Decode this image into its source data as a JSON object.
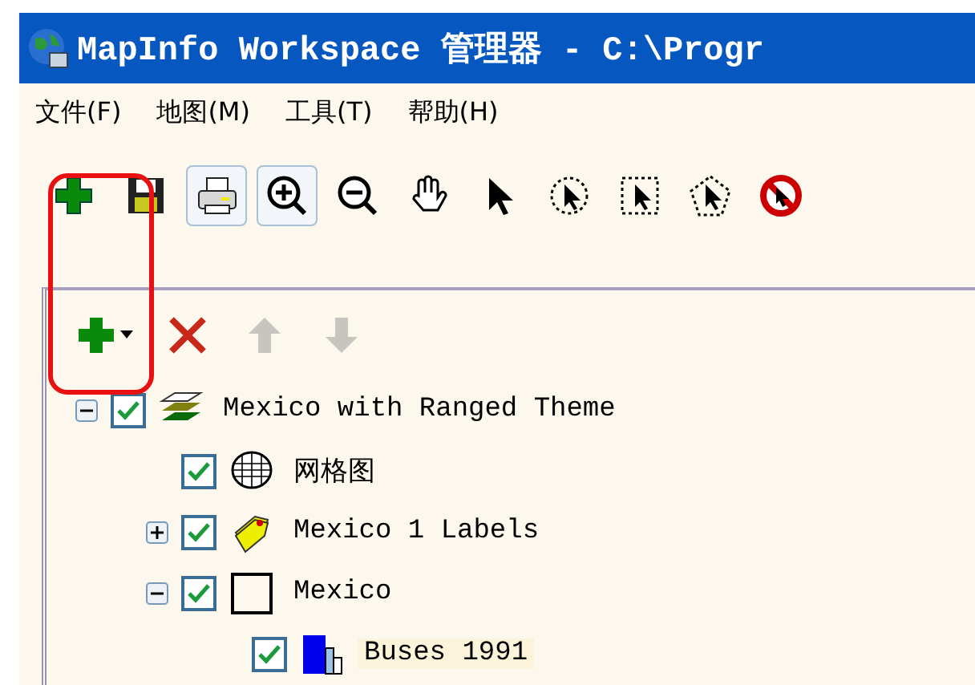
{
  "window": {
    "title": "MapInfo Workspace 管理器 - C:\\Progr"
  },
  "menu": [
    {
      "label": "文件(F)"
    },
    {
      "label": "地图(M)"
    },
    {
      "label": "工具(T)"
    },
    {
      "label": "帮助(H)"
    }
  ],
  "toolbar": [
    {
      "kind": "add",
      "selected": false
    },
    {
      "kind": "save",
      "selected": false
    },
    {
      "kind": "print",
      "selected": true
    },
    {
      "kind": "zoom-in",
      "selected": true
    },
    {
      "kind": "zoom-out",
      "selected": false
    },
    {
      "kind": "pan",
      "selected": false
    },
    {
      "kind": "pointer",
      "selected": false
    },
    {
      "kind": "radius-select",
      "selected": false
    },
    {
      "kind": "marquee-select",
      "selected": false
    },
    {
      "kind": "polygon-select",
      "selected": false
    },
    {
      "kind": "clear",
      "selected": false
    }
  ],
  "layer_toolbar": [
    {
      "kind": "add-menu",
      "disabled": false
    },
    {
      "kind": "remove",
      "disabled": false
    },
    {
      "kind": "up",
      "disabled": true
    },
    {
      "kind": "down",
      "disabled": true
    }
  ],
  "tree": [
    {
      "label": "Mexico with Ranged Theme",
      "kind": "layers",
      "checked": true,
      "expanded": true,
      "children": [
        {
          "label": "网格图",
          "kind": "grid",
          "checked": true
        },
        {
          "label": "Mexico 1 Labels",
          "kind": "labels",
          "checked": true,
          "expanded": false
        },
        {
          "label": "Mexico",
          "kind": "region",
          "checked": true,
          "expanded": true,
          "children": [
            {
              "label": "Buses 1991",
              "kind": "bars",
              "checked": true,
              "selected": true
            }
          ]
        }
      ]
    }
  ],
  "highlight": {
    "kind": "annotation"
  }
}
